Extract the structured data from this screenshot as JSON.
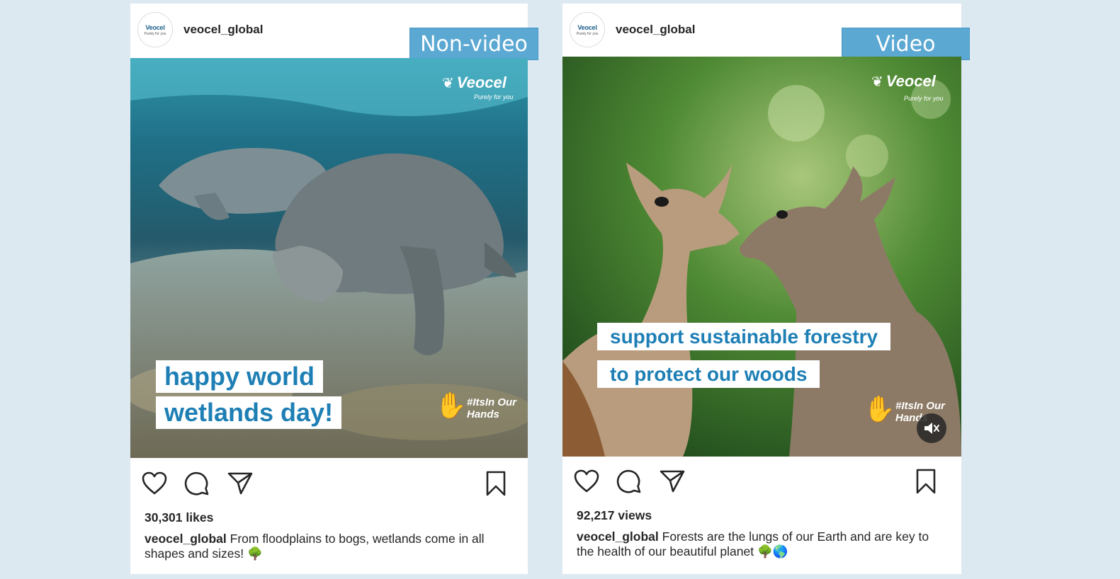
{
  "posts": [
    {
      "username": "veocel_global",
      "avatar_logo": "Veocel",
      "avatar_sub": "Purely for you",
      "more_icon": "...",
      "tag_label": "Non-video",
      "watermark_brand": "Veocel",
      "watermark_tagline": "Purely for you",
      "hashtag_mark": "#ItsIn Our Hands",
      "overlay_lines": [
        "happy world",
        "wetlands day!"
      ],
      "stat": "30,301 likes",
      "caption_text": "From floodplains to bogs, wetlands come in all shapes and sizes!",
      "caption_emoji": "🌳",
      "image_scene": "manatees-underwater"
    },
    {
      "username": "veocel_global",
      "avatar_logo": "Veocel",
      "avatar_sub": "Purely for you",
      "more_icon": "...",
      "tag_label": "Video",
      "watermark_brand": "Veocel",
      "watermark_tagline": "Purely for you",
      "hashtag_mark": "#ItsIn Our Hands",
      "overlay_lines": [
        "support sustainable forestry",
        "to protect our woods"
      ],
      "stat": "92,217 views",
      "caption_text": "Forests are the lungs of our Earth and are key to the health of our beautiful planet",
      "caption_emoji": "🌳🌎",
      "image_scene": "deer-in-forest",
      "mute_icon": "muted-speaker-icon"
    }
  ],
  "icons": {
    "like": "heart-icon",
    "comment": "comment-bubble-icon",
    "share": "paper-plane-icon",
    "save": "bookmark-icon"
  },
  "colors": {
    "background": "#dde9f1",
    "tag_label_bg": "#5ba8d3",
    "overlay_text": "#1e7fb5"
  }
}
